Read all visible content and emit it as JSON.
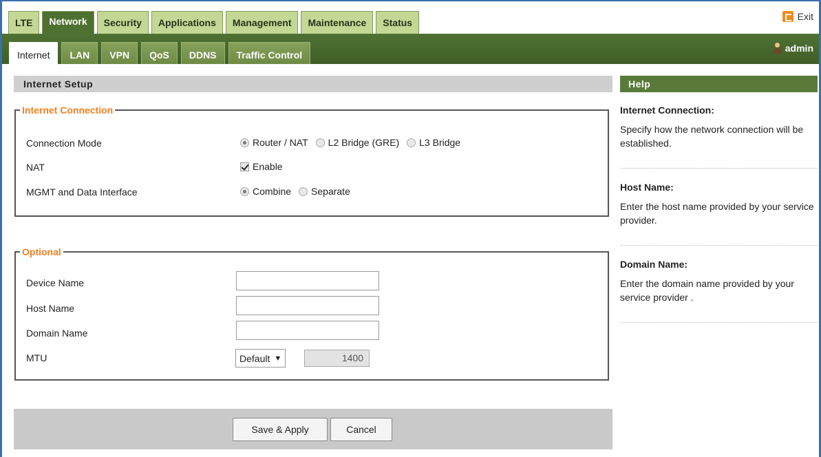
{
  "main_tabs": [
    {
      "label": "LTE"
    },
    {
      "label": "Network"
    },
    {
      "label": "Security"
    },
    {
      "label": "Applications"
    },
    {
      "label": "Management"
    },
    {
      "label": "Maintenance"
    },
    {
      "label": "Status"
    }
  ],
  "exit_label": "Exit",
  "sub_tabs": [
    {
      "label": "Internet"
    },
    {
      "label": "LAN"
    },
    {
      "label": "VPN"
    },
    {
      "label": "QoS"
    },
    {
      "label": "DDNS"
    },
    {
      "label": "Traffic Control"
    }
  ],
  "user_label": "admin",
  "section_title": "Internet Setup",
  "help_title": "Help",
  "connection": {
    "legend": "Internet Connection",
    "mode_label": "Connection Mode",
    "mode_options": [
      "Router / NAT",
      "L2 Bridge (GRE)",
      "L3 Bridge"
    ],
    "mode_selected": "Router / NAT",
    "nat_label": "NAT",
    "nat_option": "Enable",
    "nat_checked": true,
    "mgmt_label": "MGMT and Data Interface",
    "mgmt_options": [
      "Combine",
      "Separate"
    ],
    "mgmt_selected": "Combine"
  },
  "optional": {
    "legend": "Optional",
    "device_name_label": "Device Name",
    "device_name_value": "",
    "host_name_label": "Host Name",
    "host_name_value": "",
    "domain_name_label": "Domain Name",
    "domain_name_value": "",
    "mtu_label": "MTU",
    "mtu_select": "Default",
    "mtu_value": "1400"
  },
  "buttons": {
    "save": "Save & Apply",
    "cancel": "Cancel"
  },
  "help": [
    {
      "title": "Internet Connection:",
      "text": "Specify how the network connection will be established."
    },
    {
      "title": "Host Name:",
      "text": "Enter the host name provided by your service provider."
    },
    {
      "title": "Domain Name:",
      "text": "Enter the domain name provided by your service provider ."
    }
  ],
  "colors": {
    "active_tab": "#4e7030",
    "tab": "#c4d896",
    "legend": "#f08020",
    "help_header": "#5a7a3a",
    "frame": "#3a6fb0"
  }
}
